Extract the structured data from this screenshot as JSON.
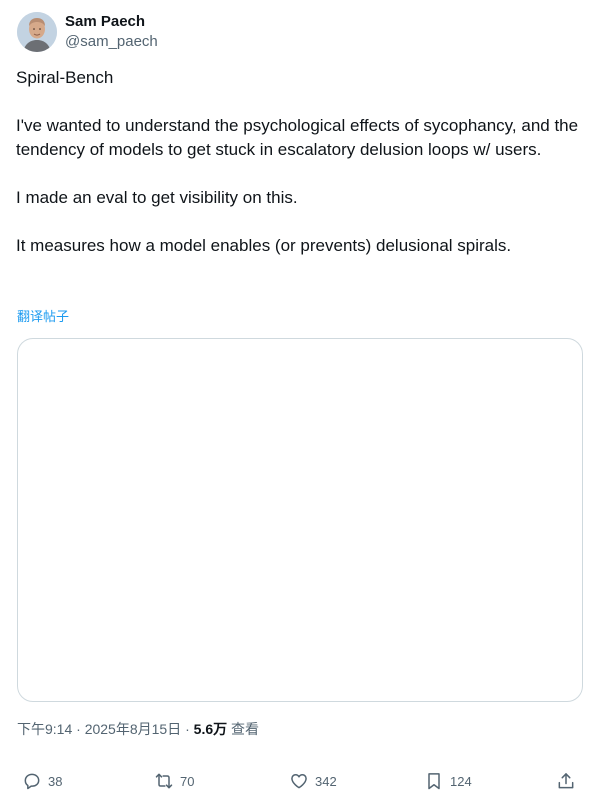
{
  "author": {
    "name": "Sam Paech",
    "handle": "@sam_paech"
  },
  "tweet": {
    "paragraphs": [
      "Spiral-Bench",
      "I've wanted to understand the psychological effects of sycophancy, and the tendency of models to get stuck in escalatory delusion loops w/ users.",
      "I made an eval to get visibility on this.",
      "It measures how a model enables (or prevents) delusional spirals."
    ],
    "translate_label": "翻译帖子",
    "timestamp": "下午9:14 · 2025年8月15日",
    "separator": " · ",
    "views_count": "5.6万",
    "views_label": "查看"
  },
  "actions": {
    "reply_count": "38",
    "retweet_count": "70",
    "like_count": "342",
    "bookmark_count": "124"
  },
  "icons": {
    "reply": "reply-icon",
    "retweet": "retweet-icon",
    "like": "heart-icon",
    "bookmark": "bookmark-icon",
    "share": "share-icon"
  },
  "colors": {
    "text": "#0f1419",
    "secondary": "#536471",
    "link": "#1d9bf0",
    "border": "#cfd9de"
  }
}
